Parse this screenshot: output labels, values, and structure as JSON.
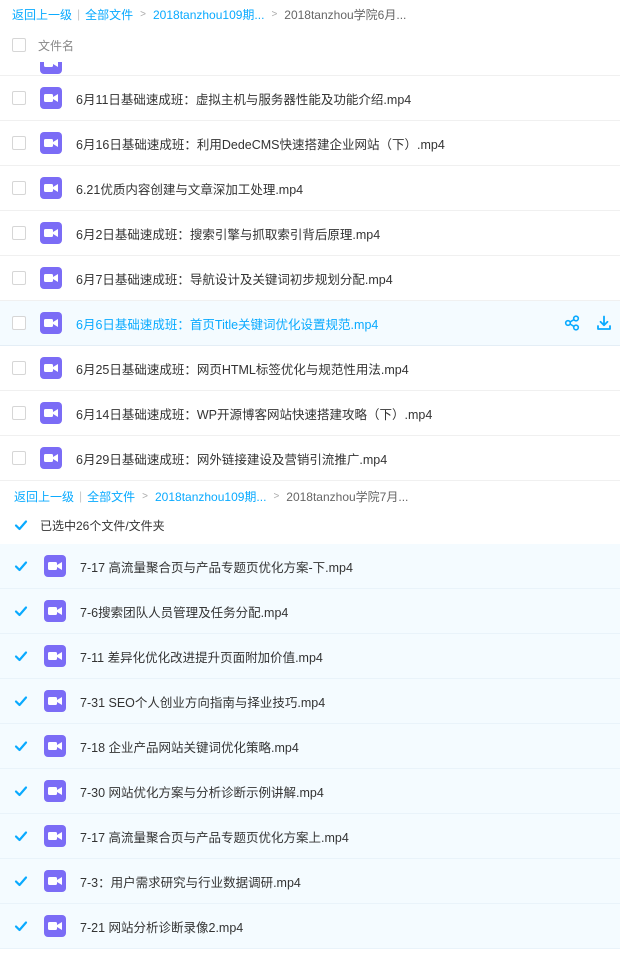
{
  "panel1": {
    "breadcrumb": {
      "back": "返回上一级",
      "all_files": "全部文件",
      "folder": "2018tanzhou109期...",
      "current": "2018tanzhou学院6月..."
    },
    "header": {
      "column_name": "文件名"
    },
    "files": [
      "6月11日基础速成班：虚拟主机与服务器性能及功能介绍.mp4",
      "6月16日基础速成班：利用DedeCMS快速搭建企业网站（下）.mp4",
      "6.21优质内容创建与文章深加工处理.mp4",
      "6月2日基础速成班：搜索引擎与抓取索引背后原理.mp4",
      "6月7日基础速成班：导航设计及关键词初步规划分配.mp4",
      "6月6日基础速成班：首页Title关键词优化设置规范.mp4",
      "6月25日基础速成班：网页HTML标签优化与规范性用法.mp4",
      "6月14日基础速成班：WP开源博客网站快速搭建攻略（下）.mp4",
      "6月29日基础速成班：网外链接建设及营销引流推广.mp4"
    ],
    "hover_index": 5
  },
  "panel2": {
    "breadcrumb": {
      "back": "返回上一级",
      "all_files": "全部文件",
      "folder": "2018tanzhou109期...",
      "current": "2018tanzhou学院7月..."
    },
    "header": {
      "selected_text": "已选中26个文件/文件夹"
    },
    "files": [
      "7-17 高流量聚合页与产品专题页优化方案-下.mp4",
      "7-6搜索团队人员管理及任务分配.mp4",
      "7-11 差异化优化改进提升页面附加价值.mp4",
      "7-31 SEO个人创业方向指南与择业技巧.mp4",
      "7-18 企业产品网站关键词优化策略.mp4",
      "7-30 网站优化方案与分析诊断示例讲解.mp4",
      "7-17 高流量聚合页与产品专题页优化方案上.mp4",
      "7-3：用户需求研究与行业数据调研.mp4",
      "7-21 网站分析诊断录像2.mp4"
    ]
  },
  "colors": {
    "accent": "#09aaff",
    "video_icon": "#7b6cf6",
    "selected_bg": "#f4fbff"
  },
  "icons": {
    "file": "video-file-icon",
    "share": "share-icon",
    "download": "download-icon",
    "check": "check-icon"
  }
}
